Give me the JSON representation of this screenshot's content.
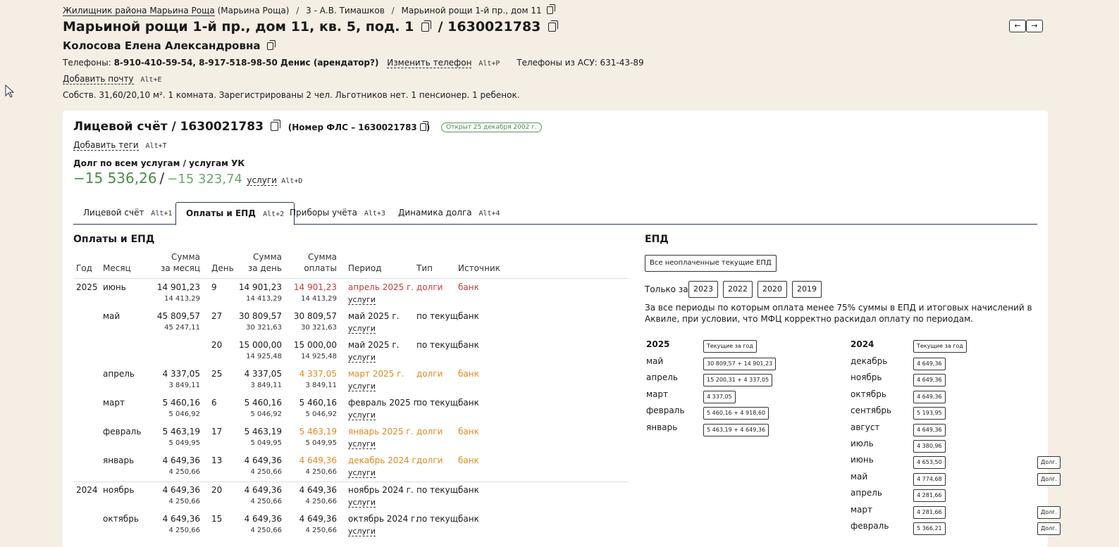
{
  "breadcrumb": {
    "org": "Жилищник района Марьина Роща",
    "org_suffix": "(Марьина Роща)",
    "manager": "3 - А.В. Тимашков",
    "building": "Марьиной рощи 1-й пр., дом 11"
  },
  "address": {
    "text": "Марьиной рощи 1-й пр., дом 11, кв. 5, под. 1",
    "account": "/ 1630021783"
  },
  "owner": "Колосова Елена Александровна",
  "phones": {
    "label": "Телефоны:",
    "value": "8-910-410-59-54, 8-917-518-98-50 Денис (арендатор?)",
    "change_link": "Изменить телефон",
    "change_hotkey": "Alt+P",
    "asu": "Телефоны из АСУ: 631-43-89"
  },
  "email": {
    "link": "Добавить почту",
    "hotkey": "Alt+E"
  },
  "summary": "Собств. 31,60/20,10 м². 1 комната. Зарегистрированы 2 чел. Льготников нет. 1 пенсионер. 1 ребенок.",
  "nav": {
    "prev": "←",
    "next": "→"
  },
  "account_card": {
    "title": "Лицевой счёт / 1630021783",
    "fls": "(Номер ФЛС – 1630021783",
    "fls_close": ")",
    "badge": "Открыт 25 декабря 2002 г.",
    "tags_link": "Добавить теги",
    "tags_hotkey": "Alt+T",
    "debt_label": "Долг по всем услугам / услугам УК",
    "debt_all": "−15 536,26",
    "debt_slash": "/",
    "debt_uk": "−15 323,74",
    "debt_services": "услуги",
    "debt_hotkey": "Alt+D"
  },
  "tabs": [
    {
      "label": "Лицевой счёт",
      "hotkey": "Alt+1"
    },
    {
      "label": "Оплаты и ЕПД",
      "hotkey": "Alt+2"
    },
    {
      "label": "Приборы учёта",
      "hotkey": "Alt+3"
    },
    {
      "label": "Динамика долга",
      "hotkey": "Alt+4"
    }
  ],
  "payments": {
    "title": "Оплаты и ЕПД",
    "headers": {
      "year": "Год",
      "month": "Месяц",
      "sum_month_1": "Сумма",
      "sum_month_2": "за месяц",
      "day": "День",
      "sum_day_1": "Сумма",
      "sum_day_2": "за день",
      "sum_pay_1": "Сумма",
      "sum_pay_2": "оплаты",
      "period": "Период",
      "type": "Тип",
      "source": "Источник"
    },
    "rows": [
      {
        "year": "2025",
        "month": "июнь",
        "sm": "14 901,23",
        "sm2": "14 413,29",
        "day": "9",
        "sd": "14 901,23",
        "sd2": "14 413,29",
        "sp": "14 901,23",
        "sp2": "14 413,29",
        "period": "апрель 2025 г.",
        "services": "услуги",
        "type": "долги",
        "source": "банк",
        "color": "red"
      },
      {
        "year": "",
        "month": "май",
        "sm": "45 809,57",
        "sm2": "45 247,11",
        "day": "27",
        "sd": "30 809,57",
        "sd2": "30 321,63",
        "sp": "30 809,57",
        "sp2": "30 321,63",
        "period": "май 2025 г.",
        "services": "услуги",
        "type": "по текущ.",
        "source": "банк",
        "color": ""
      },
      {
        "year": "",
        "month": "",
        "sm": "",
        "sm2": "",
        "day": "20",
        "sd": "15 000,00",
        "sd2": "14 925,48",
        "sp": "15 000,00",
        "sp2": "14 925,48",
        "period": "май 2025 г.",
        "services": "услуги",
        "type": "по текущ.",
        "source": "банк",
        "color": ""
      },
      {
        "year": "",
        "month": "апрель",
        "sm": "4 337,05",
        "sm2": "3 849,11",
        "day": "25",
        "sd": "4 337,05",
        "sd2": "3 849,11",
        "sp": "4 337,05",
        "sp2": "3 849,11",
        "period": "март 2025 г.",
        "services": "услуги",
        "type": "долги",
        "source": "банк",
        "color": "orange"
      },
      {
        "year": "",
        "month": "март",
        "sm": "5 460,16",
        "sm2": "5 046,92",
        "day": "6",
        "sd": "5 460,16",
        "sd2": "5 046,92",
        "sp": "5 460,16",
        "sp2": "5 046,92",
        "period": "февраль 2025 г.",
        "services": "услуги",
        "type": "по текущ.",
        "source": "банк",
        "color": ""
      },
      {
        "year": "",
        "month": "февраль",
        "sm": "5 463,19",
        "sm2": "5 049,95",
        "day": "17",
        "sd": "5 463,19",
        "sd2": "5 049,95",
        "sp": "5 463,19",
        "sp2": "5 049,95",
        "period": "январь 2025 г.",
        "services": "услуги",
        "type": "долги",
        "source": "банк",
        "color": "orange"
      },
      {
        "year": "",
        "month": "январь",
        "sm": "4 649,36",
        "sm2": "4 250,66",
        "day": "13",
        "sd": "4 649,36",
        "sd2": "4 250,66",
        "sp": "4 649,36",
        "sp2": "4 250,66",
        "period": "декабрь 2024 г.",
        "services": "услуги",
        "type": "долги",
        "source": "банк",
        "color": "orange"
      },
      {
        "year": "2024",
        "month": "ноябрь",
        "sm": "4 649,36",
        "sm2": "4 250,66",
        "day": "20",
        "sd": "4 649,36",
        "sd2": "4 250,66",
        "sp": "4 649,36",
        "sp2": "4 250,66",
        "period": "ноябрь 2024 г.",
        "services": "услуги",
        "type": "по текущ.",
        "source": "банк",
        "color": ""
      },
      {
        "year": "",
        "month": "октябрь",
        "sm": "4 649,36",
        "sm2": "4 250,66",
        "day": "15",
        "sd": "4 649,36",
        "sd2": "4 250,66",
        "sp": "4 649,36",
        "sp2": "4 250,66",
        "period": "октябрь 2024 г.",
        "services": "услуги",
        "type": "по текущ.",
        "source": "банк",
        "color": ""
      }
    ]
  },
  "epd": {
    "title": "ЕПД",
    "unpaid_button": "Все неоплаченные текущие ЕПД",
    "only_label": "Только за",
    "years": [
      "2023",
      "2022",
      "2020",
      "2019"
    ],
    "note": "За все периоды по которым оплата менее 75% суммы в ЕПД и итоговых начислений в Аквиле, при условии, что МФЦ корректно раскидал оплату по периодам.",
    "columns": [
      {
        "year": "2025",
        "current_btn": "Текущие за год",
        "months": [
          {
            "name": "май",
            "value": "30 809,57 + 14 901,23",
            "debt": ""
          },
          {
            "name": "апрель",
            "value": "15 200,31 + 4 337,05",
            "debt": ""
          },
          {
            "name": "март",
            "value": "4 337,05",
            "debt": ""
          },
          {
            "name": "февраль",
            "value": "5 460,16 + 4 918,60",
            "debt": ""
          },
          {
            "name": "январь",
            "value": "5 463,19 + 4 649,36",
            "debt": ""
          }
        ]
      },
      {
        "year": "2024",
        "current_btn": "Текущие за год",
        "months": [
          {
            "name": "декабрь",
            "value": "4 649,36",
            "debt": ""
          },
          {
            "name": "ноябрь",
            "value": "4 649,36",
            "debt": ""
          },
          {
            "name": "октябрь",
            "value": "4 649,36",
            "debt": ""
          },
          {
            "name": "сентябрь",
            "value": "5 193,95",
            "debt": ""
          },
          {
            "name": "август",
            "value": "4 649,36",
            "debt": ""
          },
          {
            "name": "июль",
            "value": "4 380,96",
            "debt": ""
          },
          {
            "name": "июнь",
            "value": "4 653,50",
            "debt": "Долг."
          },
          {
            "name": "май",
            "value": "4 774,68",
            "debt": "Долг."
          },
          {
            "name": "апрель",
            "value": "4 281,66",
            "debt": ""
          },
          {
            "name": "март",
            "value": "4 281,66",
            "debt": "Долг."
          },
          {
            "name": "февраль",
            "value": "5 366,21",
            "debt": "Долг."
          }
        ]
      }
    ]
  }
}
